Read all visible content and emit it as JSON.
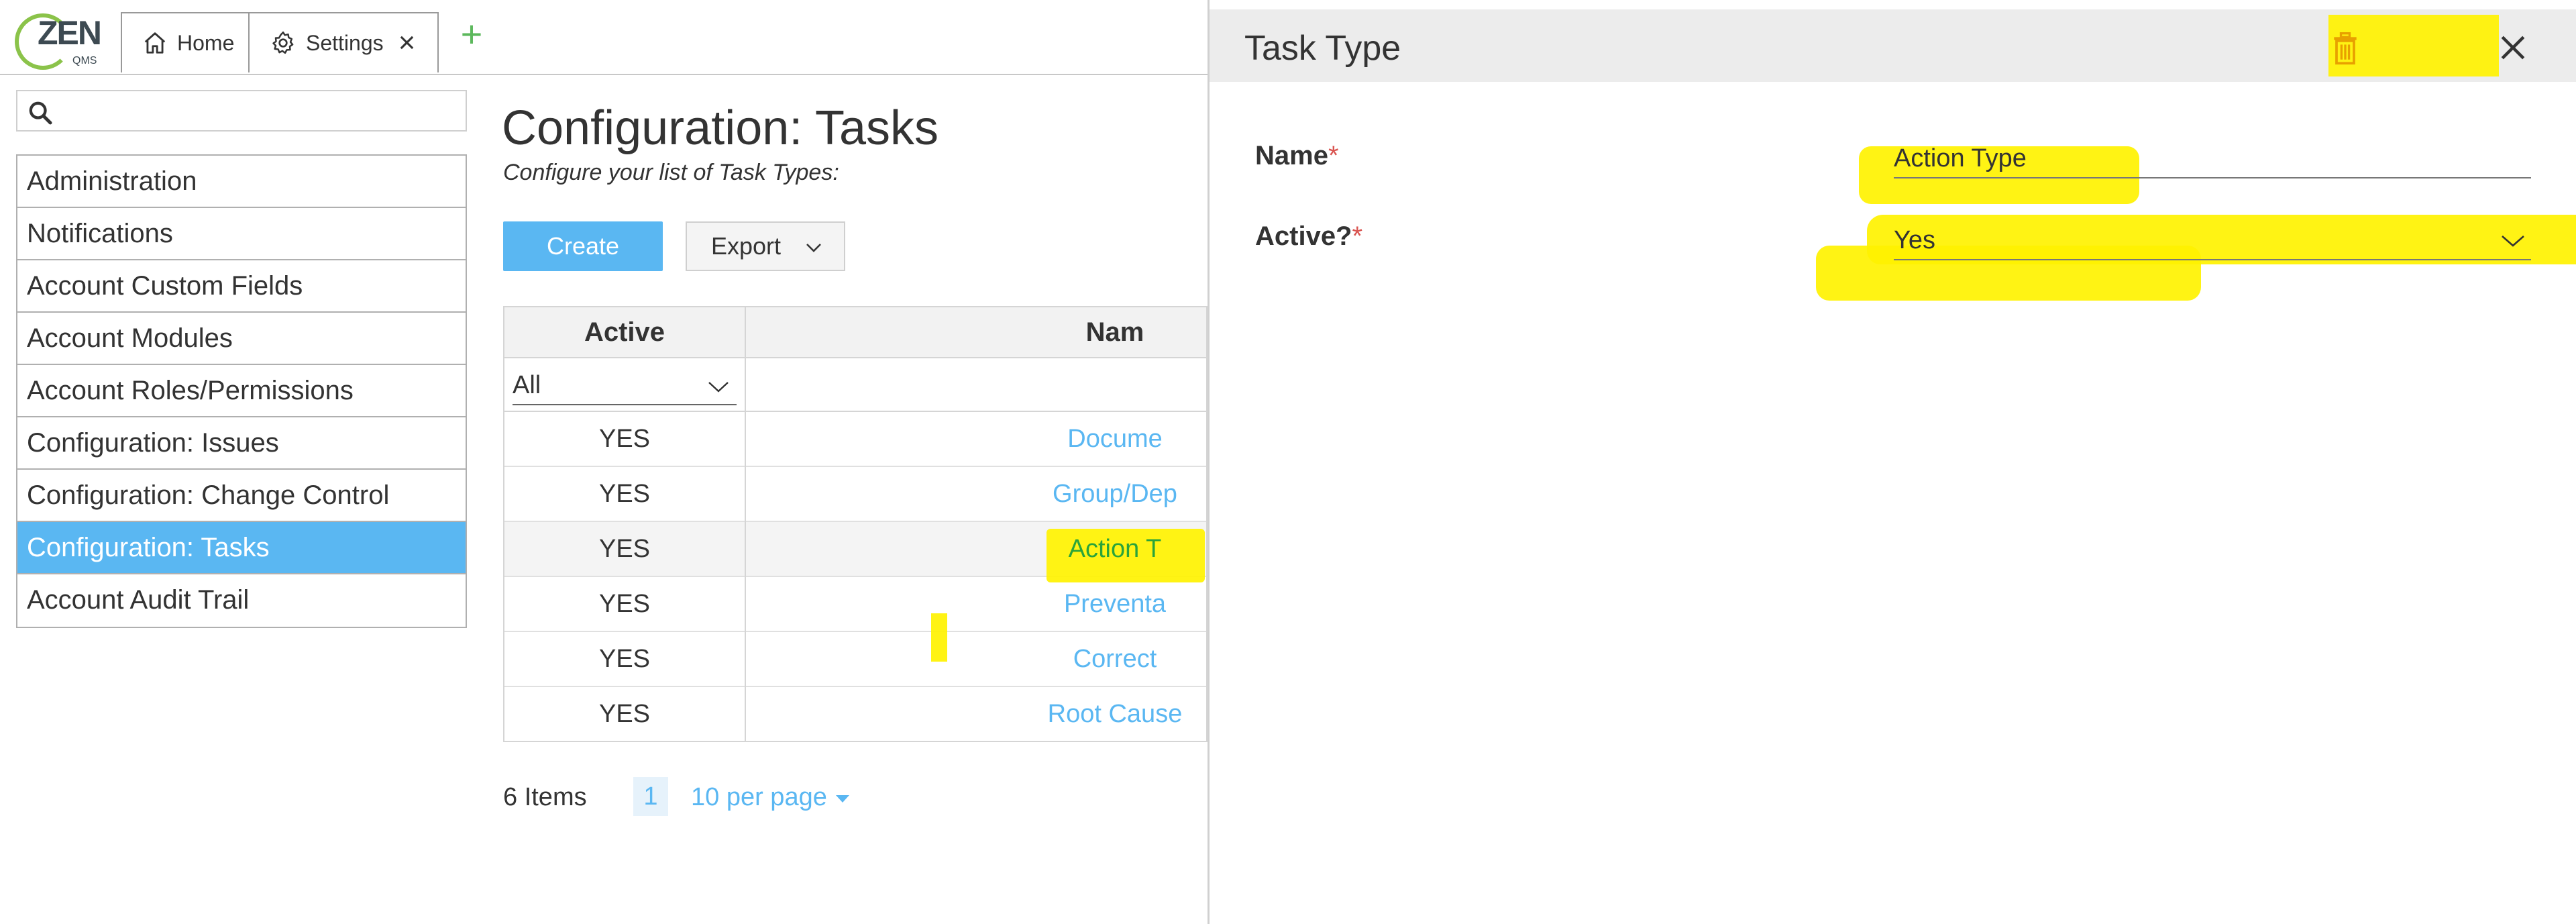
{
  "app": {
    "logo_main": "ZEN",
    "logo_sub": "QMS"
  },
  "tabs": [
    {
      "label": "Home",
      "icon": "home-icon"
    },
    {
      "label": "Settings",
      "icon": "gear-icon",
      "closable": true
    }
  ],
  "sidebar": {
    "search_placeholder": "",
    "items": [
      {
        "label": "Administration"
      },
      {
        "label": "Notifications"
      },
      {
        "label": "Account Custom Fields"
      },
      {
        "label": "Account Modules"
      },
      {
        "label": "Account Roles/Permissions"
      },
      {
        "label": "Configuration: Issues"
      },
      {
        "label": "Configuration: Change Control"
      },
      {
        "label": "Configuration: Tasks",
        "active": true
      },
      {
        "label": "Account Audit Trail"
      }
    ]
  },
  "main": {
    "title": "Configuration: Tasks",
    "subtitle": "Configure your list of Task Types:",
    "create_label": "Create",
    "export_label": "Export",
    "grid": {
      "headers": {
        "active": "Active",
        "name": "Nam"
      },
      "filter_value": "All",
      "rows": [
        {
          "active": "YES",
          "name": "Docume"
        },
        {
          "active": "YES",
          "name": "Group/Dep"
        },
        {
          "active": "YES",
          "name": "Action T"
        },
        {
          "active": "YES",
          "name": "Preventa"
        },
        {
          "active": "YES",
          "name": "Correct"
        },
        {
          "active": "YES",
          "name": "Root Cause"
        }
      ]
    },
    "pager": {
      "items_text": "6 Items",
      "current_page": "1",
      "per_page": "10 per page"
    }
  },
  "panel": {
    "title": "Task Type",
    "fields": [
      {
        "label": "Name",
        "required_mark": "*",
        "value": "Action Type"
      },
      {
        "label": "Active?",
        "required_mark": "*",
        "value": "Yes"
      }
    ]
  },
  "colors": {
    "accent": "#5ab7f2",
    "highlighter": "#fff200",
    "required": "#d9534f",
    "logo_green": "#8bc34a",
    "add_tab_green": "#5cb85c",
    "trash": "#e8a000"
  }
}
